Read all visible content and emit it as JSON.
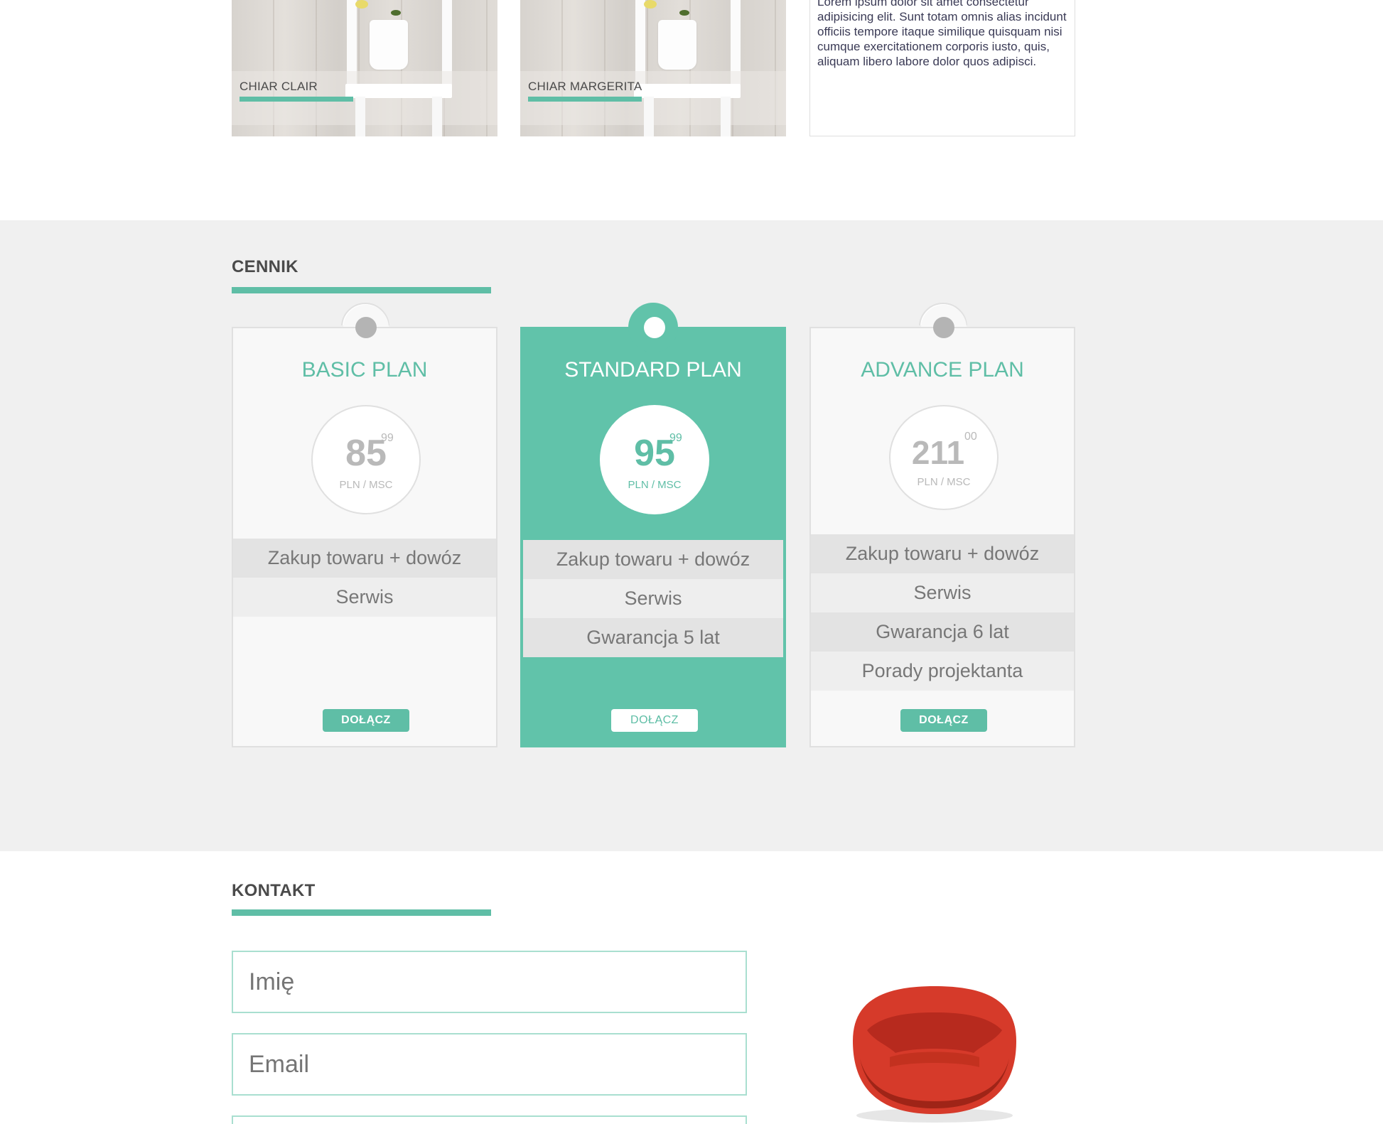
{
  "gallery": {
    "items": [
      {
        "label": "CHIAR CLAIR"
      },
      {
        "label": "CHIAR MARGERITA"
      }
    ],
    "description": "Lorem ipsum dolor sit amet consectetur adipisicing elit. Sunt totam omnis alias incidunt officiis tempore itaque similique quisquam nisi cumque exercitationem corporis iusto, quis, aliquam libero labore dolor quos adipisci."
  },
  "pricing": {
    "title": "CENNIK",
    "plans": [
      {
        "name": "BASIC PLAN",
        "price": "85",
        "cents": "99",
        "unit": "PLN / MSC",
        "features": [
          "Zakup towaru + dowóz",
          "Serwis"
        ],
        "button": "DOŁĄCZ",
        "featured": false
      },
      {
        "name": "STANDARD PLAN",
        "price": "95",
        "cents": "99",
        "unit": "PLN / MSC",
        "features": [
          "Zakup towaru + dowóz",
          "Serwis",
          "Gwarancja 5 lat"
        ],
        "button": "DOŁĄCZ",
        "featured": true
      },
      {
        "name": "ADVANCE PLAN",
        "price": "211",
        "cents": "00",
        "unit": "PLN / MSC",
        "features": [
          "Zakup towaru + dowóz",
          "Serwis",
          "Gwarancja 6 lat",
          "Porady projektanta"
        ],
        "button": "DOŁĄCZ",
        "featured": false
      }
    ]
  },
  "contact": {
    "title": "KONTAKT",
    "fields": [
      {
        "placeholder": "Imię"
      },
      {
        "placeholder": "Email"
      }
    ]
  },
  "colors": {
    "accent": "#5fbea6",
    "section_background": "#f0f0f0",
    "armchair": "#d63a2a"
  }
}
